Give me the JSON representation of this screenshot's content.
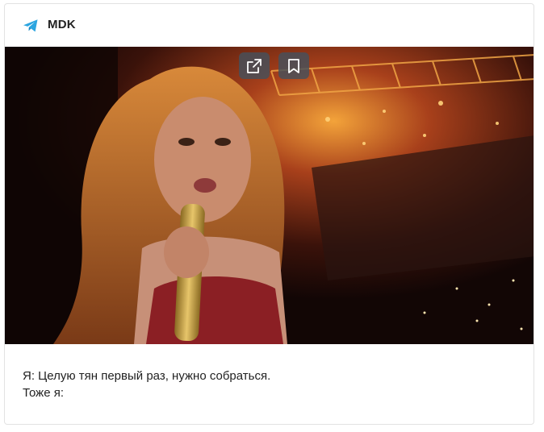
{
  "post": {
    "channel_name": "MDK",
    "channel_icon": "telegram-plane-icon",
    "caption_lines": [
      "Я: Целую тян первый раз, нужно собраться.",
      "Тоже я:"
    ],
    "media": {
      "type": "video-frame",
      "actions": [
        {
          "name": "open-external-icon"
        },
        {
          "name": "bookmark-icon"
        }
      ]
    }
  },
  "colors": {
    "accent": "#2ca5e0",
    "text": "#222222",
    "border": "#e2e2e2",
    "overlay_button": "#46505c"
  }
}
